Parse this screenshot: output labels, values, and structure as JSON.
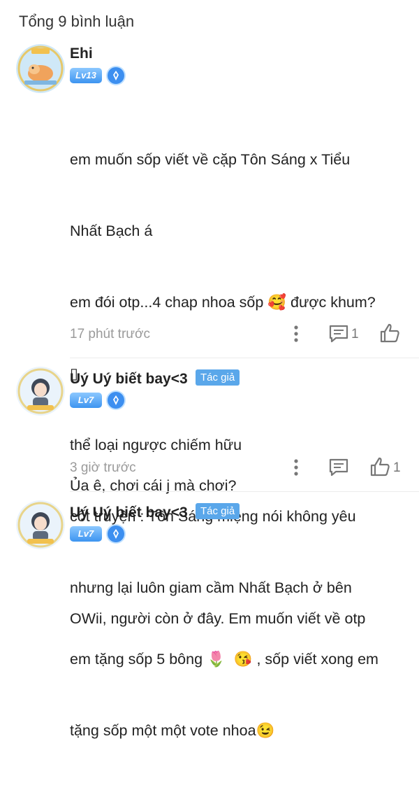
{
  "header": {
    "total_comments": "Tổng 9 bình luận"
  },
  "comments": [
    {
      "author": "Ehi",
      "level": "Lv13",
      "lines": [
        "em muốn sốp viết về cặp Tôn Sáng x Tiểu",
        "Nhất Bạch á",
        "em đói otp...4 chap nhoa sốp 🥰 được khum?",
        "▯",
        "thể loại ngược chiếm hữu",
        "cốt truyện : Tôn Sáng miệng nói không yêu",
        "nhưng lại luôn giam cầm Nhất Bạch ở bên",
        "em tặng sốp 5 bông 🌷  😘 , sốp viết xong em",
        "tặng sốp một một vote nhoa😉"
      ],
      "time": "17 phút trước",
      "reply_count": "1",
      "like_count": ""
    },
    {
      "author": "Uý Uý biết bay<3",
      "author_badge": "Tác giả",
      "level": "Lv7",
      "lines": [
        "Ủa ê, chơi cái j mà chơi?"
      ],
      "time": "3 giờ trước",
      "reply_count": "",
      "like_count": "1"
    },
    {
      "author": "Uý Uý biết bay<3",
      "author_badge": "Tác giả",
      "level": "Lv7",
      "lines": [
        "OWii, người còn ở đây. Em muốn viết về otp"
      ],
      "time": "",
      "reply_count": "",
      "like_count": ""
    }
  ],
  "colors": {
    "badge": "#5aa7ea",
    "level": "#3d94f0",
    "meta": "#9a9a9a"
  }
}
